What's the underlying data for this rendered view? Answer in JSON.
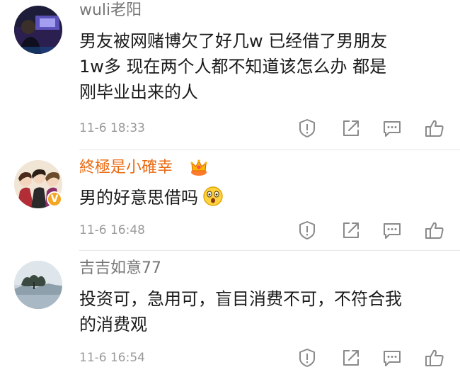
{
  "comments": [
    {
      "user": "wuli老阳",
      "lines": [
        "男友被网赌博欠了好几w  已经借了男朋友",
        "1w多  现在两个人都不知道该怎么办  都是",
        "刚毕业出来的人"
      ],
      "time": "11-6 18:33"
    },
    {
      "user": "終極是小確幸",
      "lines": [
        "男的好意思借吗"
      ],
      "time": "11-6 16:48",
      "verified_badge": "V"
    },
    {
      "user": "吉吉如意77",
      "lines": [
        "投资可，急用可，盲目消费不可，不符合我",
        "的消费观"
      ],
      "time": "11-6 16:54"
    }
  ],
  "icons": [
    "report-icon",
    "repost-icon",
    "reply-icon",
    "like-icon"
  ],
  "colors": {
    "username": "#777777",
    "vip_username": "#ea6a12",
    "time": "#9a9a9a",
    "icon": "#8a8a8a",
    "divider": "#e6e6e6"
  }
}
